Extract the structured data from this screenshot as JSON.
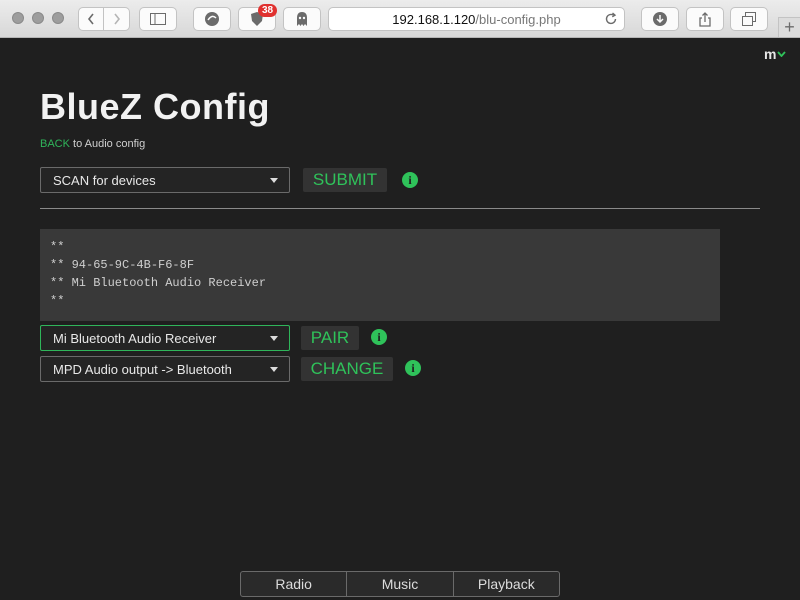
{
  "browser": {
    "address_host": "192.168.1.120",
    "address_path": "/blu-config.php",
    "extension_badge": "38",
    "new_tab_label": "+"
  },
  "header": {
    "menu_label": "m",
    "menu_chevron": "⌄"
  },
  "page": {
    "title": "BlueZ Config",
    "back_link": "BACK",
    "back_suffix": " to Audio config"
  },
  "scan": {
    "selected": "SCAN for devices",
    "submit_label": "SUBMIT"
  },
  "output": {
    "lines": [
      "**",
      "** 94-65-9C-4B-F6-8F",
      "** Mi Bluetooth Audio Receiver",
      "**"
    ]
  },
  "pair": {
    "selected": "Mi Bluetooth Audio Receiver",
    "button_label": "PAIR"
  },
  "audio_output": {
    "selected": "MPD Audio output -> Bluetooth",
    "button_label": "CHANGE"
  },
  "info_icon_glyph": "i",
  "footer": {
    "tabs": [
      "Radio",
      "Music",
      "Playback"
    ]
  },
  "colors": {
    "accent": "#2fc25a",
    "background": "#1f1f1f"
  }
}
